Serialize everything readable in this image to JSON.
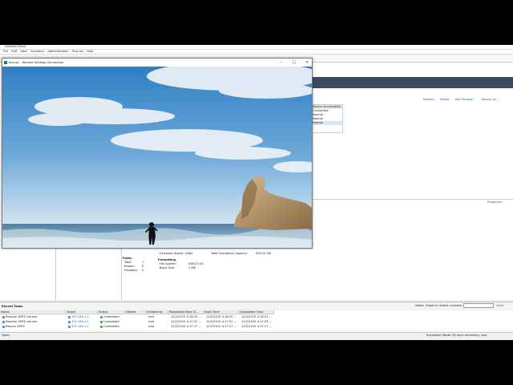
{
  "vsphere": {
    "title_text": "vSphere Client",
    "menu": [
      "File",
      "Edit",
      "View",
      "Inventory",
      "Administration",
      "Plug-ins",
      "Help"
    ],
    "links": [
      "Refresh",
      "Delete",
      "Add Storage...",
      "Rescan All..."
    ],
    "device_header": "Device Accessibility",
    "device_rows": [
      "Connected",
      "Normal",
      "Normal",
      "Normal"
    ],
    "properties_label": "Properties...",
    "details": {
      "extension_name_label": "Extension Name:",
      "extension_name_value": "SAN1",
      "total_capacity_label": "Total Formatted Capacity:",
      "total_capacity_value": "999.25 GB",
      "paths_title": "Paths",
      "paths": [
        {
          "label": "Total:",
          "value": "1"
        },
        {
          "label": "Broken:",
          "value": "0"
        },
        {
          "label": "Disabled:",
          "value": "0"
        }
      ],
      "formatting_title": "Formatting",
      "fs_label": "File System:",
      "fs_value": "VMFS 5.61",
      "block_label": "Block Size:",
      "block_value": "1 MB"
    },
    "recent_tasks": {
      "title": "Recent Tasks",
      "filter_label": "Name, Target or Status contains:",
      "filter_value": "",
      "clear_label": "Clear",
      "columns": [
        "Name",
        "Target",
        "Status",
        "Details",
        "Initiated by",
        "Requested Start Ti...",
        "Start Time",
        "Completed Time"
      ],
      "rows": [
        {
          "name": "Resolve VMFS volume",
          "target": "192.168.1.2",
          "status": "Completed",
          "details": "",
          "initiated_by": "root",
          "requested": "12/2/2015 4:18:19 ...",
          "start": "12/2/2015 4:18:19 ...",
          "completed": "12/2/2015 4:18:21 ..."
        },
        {
          "name": "Resolve VMFS volume",
          "target": "192.168.1.2",
          "status": "Completed",
          "details": "",
          "initiated_by": "root",
          "requested": "12/2/2015 4:17:31 ...",
          "start": "12/2/2015 4:17:31 ...",
          "completed": "12/2/2015 4:17:33 ..."
        },
        {
          "name": "Rescan VMFS",
          "target": "192.168.1.2",
          "status": "Completed",
          "details": "",
          "initiated_by": "root",
          "requested": "12/2/2015 4:17:17 ...",
          "start": "12/2/2015 4:17:17 ...",
          "completed": "12/2/2015 4:17:17 ..."
        }
      ]
    },
    "status_tasks": "Tasks",
    "status_eval": "Evaluation Mode: 60 days remaining",
    "status_user": "root"
  },
  "rdp": {
    "title": "devr.pc - Remote Desktop Connection",
    "controls": {
      "minimize": "–",
      "maximize": "□",
      "close": "✕"
    }
  },
  "colors": {
    "vsphere_header": "#3b4a5e",
    "link": "#2a5db0",
    "status_ok": "#2e9d3a"
  }
}
